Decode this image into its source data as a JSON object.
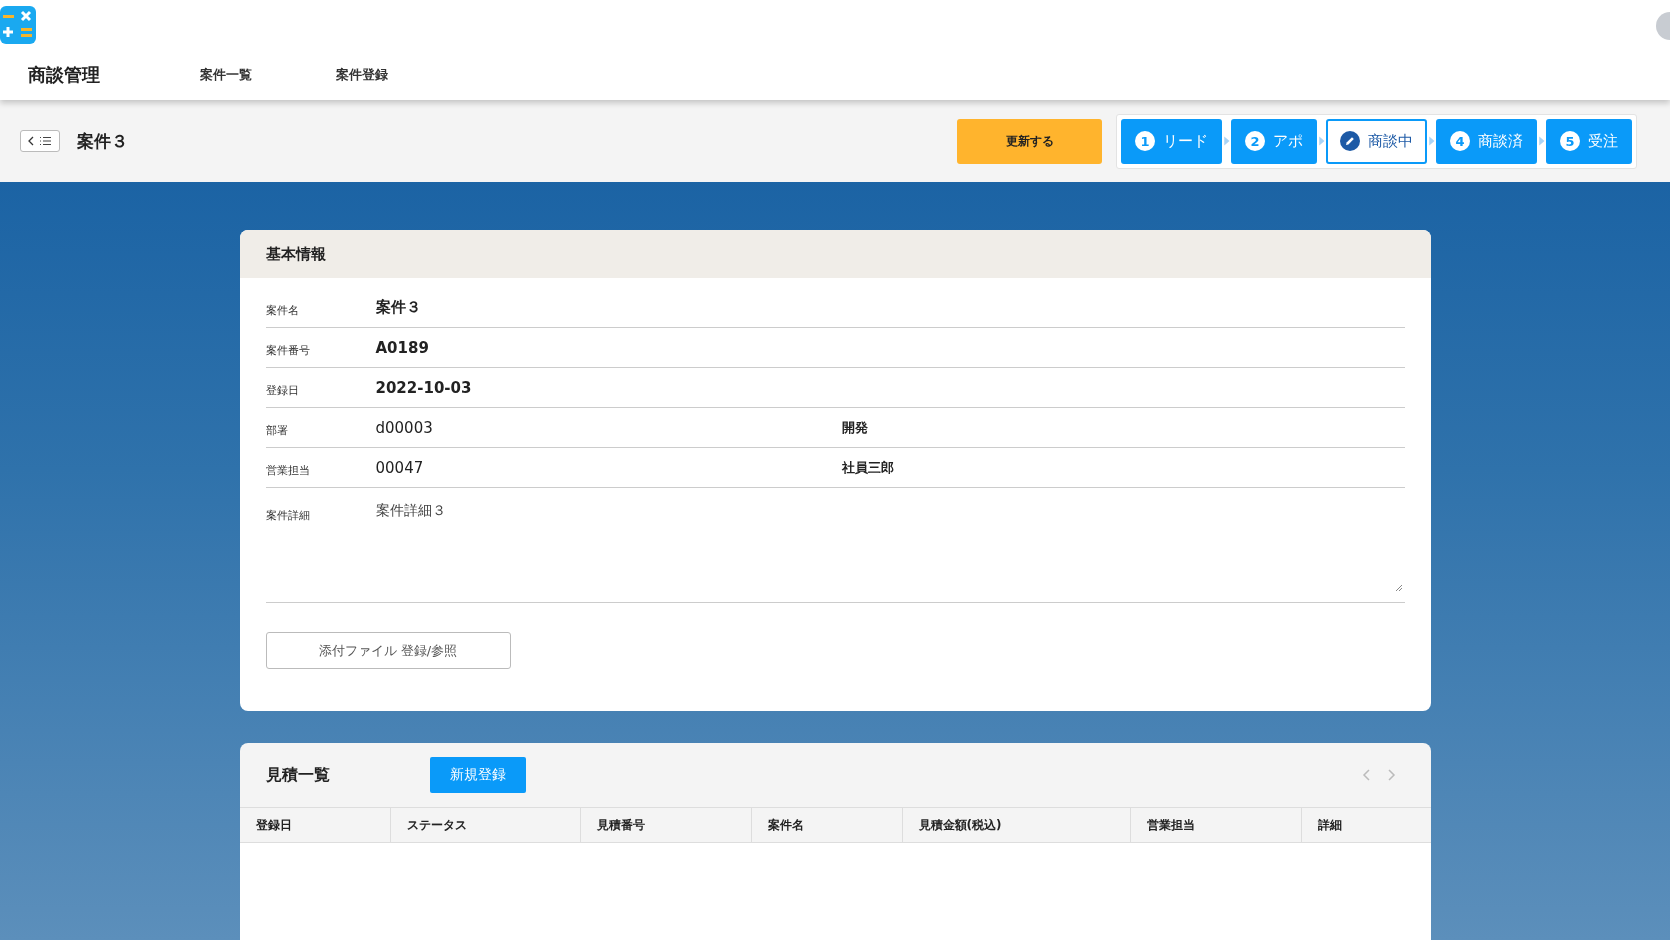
{
  "app": {
    "title": "商談管理"
  },
  "nav": [
    {
      "label": "案件一覧"
    },
    {
      "label": "案件登録"
    }
  ],
  "page": {
    "title": "案件３",
    "update_button": "更新する"
  },
  "steps": [
    {
      "number": "1",
      "label": "リード",
      "selected": false
    },
    {
      "number": "2",
      "label": "アポ",
      "selected": false
    },
    {
      "label": "商談中",
      "selected": true
    },
    {
      "number": "4",
      "label": "商談済",
      "selected": false
    },
    {
      "number": "5",
      "label": "受注",
      "selected": false
    }
  ],
  "basic_info": {
    "title": "基本情報",
    "fields": [
      {
        "kind": "text",
        "label": "案件名",
        "value": "案件３"
      },
      {
        "kind": "text",
        "label": "案件番号",
        "value": "A0189"
      },
      {
        "kind": "text",
        "label": "登録日",
        "value": "2022-10-03"
      },
      {
        "kind": "code",
        "label": "部署",
        "value": "d00003",
        "name": "開発"
      },
      {
        "kind": "code",
        "label": "営業担当",
        "value": "00047",
        "name": "社員三郎"
      },
      {
        "kind": "textarea",
        "label": "案件詳細",
        "value": "案件詳細３"
      }
    ],
    "attach_button": "添付ファイル 登録/参照"
  },
  "estimates": {
    "title": "見積一覧",
    "new_button": "新規登録",
    "columns": [
      "登録日",
      "ステータス",
      "見積番号",
      "案件名",
      "見積金額(税込)",
      "営業担当",
      "詳細"
    ]
  }
}
